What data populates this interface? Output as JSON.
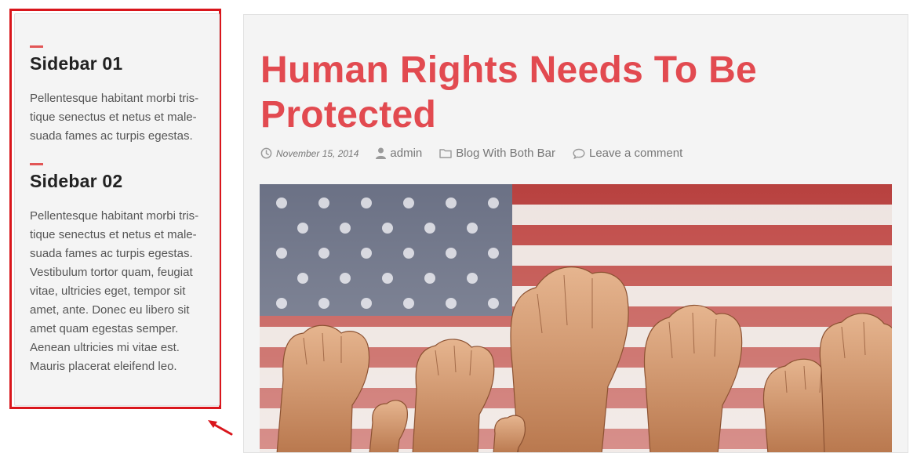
{
  "sidebar": {
    "widgets": [
      {
        "title": "Sidebar 01",
        "text": "Pellentesque habitant morbi tris-tique senectus et netus et male-suada fames ac turpis egestas."
      },
      {
        "title": "Sidebar 02",
        "text": "Pellentesque habitant morbi tris-tique senectus et netus et male-suada fames ac turpis egestas. Vestibulum tortor quam, feugiat vitae, ultricies eget, tempor sit amet, ante. Donec eu libero sit amet quam egestas semper. Aenean ultricies mi vitae est. Mauris placerat eleifend leo."
      }
    ]
  },
  "post": {
    "title": "Human Rights Needs To Be Protected",
    "meta": {
      "date": "November 15, 2014",
      "author": "admin",
      "category": "Blog With Both Bar",
      "comments": "Leave a comment"
    }
  },
  "colors": {
    "accent": "#e24a50",
    "highlight_frame": "#d9161c",
    "panel_bg": "#f4f4f4",
    "text": "#555555"
  },
  "icons": {
    "date": "clock-icon",
    "author": "user-icon",
    "category": "folder-icon",
    "comments": "comment-icon",
    "annotation": "pointer-arrow-icon"
  }
}
